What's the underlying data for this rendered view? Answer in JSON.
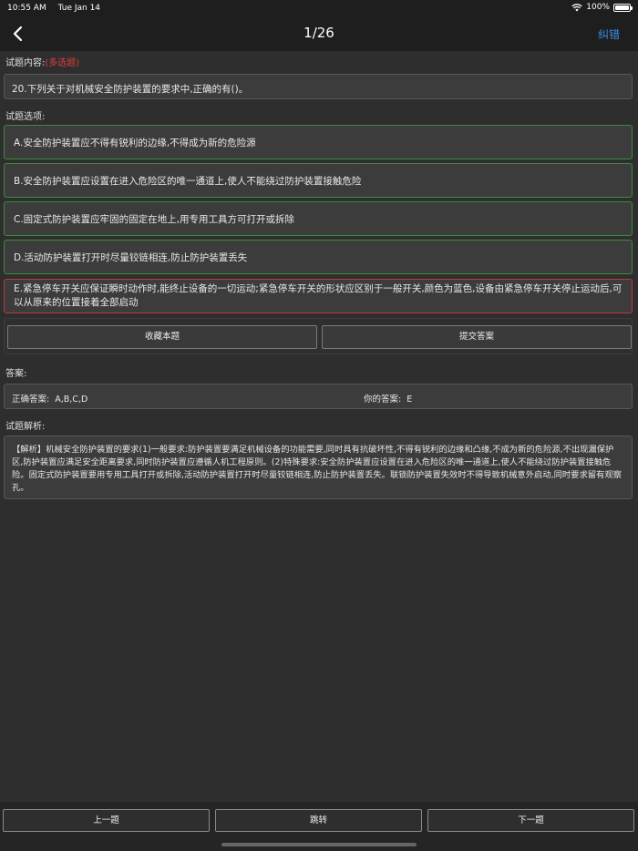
{
  "status_bar": {
    "time": "10:55 AM",
    "date": "Tue Jan 14",
    "battery_percent": "100%",
    "battery_level": 1.0
  },
  "nav": {
    "title": "1/26",
    "report_label": "纠错",
    "back_icon": "chevron-left-icon"
  },
  "question": {
    "section_label": "试题内容:",
    "type_label": "(多选题)",
    "text": "20.下列关于对机械安全防护装置的要求中,正确的有()。"
  },
  "options": {
    "section_label": "试题选项:",
    "items": [
      {
        "text": "A.安全防护装置应不得有锐利的边缘,不得成为新的危险源",
        "state": "correct"
      },
      {
        "text": "B.安全防护装置应设置在进入危险区的唯一通道上,使人不能绕过防护装置接触危险",
        "state": "correct"
      },
      {
        "text": "C.固定式防护装置应牢固的固定在地上,用专用工具方可打开或拆除",
        "state": "correct"
      },
      {
        "text": "D.活动防护装置打开时尽量铰链相连,防止防护装置丢失",
        "state": "correct"
      },
      {
        "text": "E.紧急停车开关应保证瞬时动作时,能终止设备的一切运动;紧急停车开关的形状应区别于一般开关,颜色为蓝色,设备由紧急停车开关停止运动后,可以从原来的位置接着全部启动",
        "state": "wrong"
      }
    ],
    "correct_border_color": "#3e8a3e",
    "wrong_border_color": "#b83a3a"
  },
  "actions": {
    "favorite_label": "收藏本题",
    "submit_label": "提交答案"
  },
  "answer": {
    "section_label": "答案:",
    "correct_label": "正确答案:",
    "correct_value": "A,B,C,D",
    "yours_label": "你的答案:",
    "yours_value": "E"
  },
  "analysis": {
    "section_label": "试题解析:",
    "text": "【解析】机械安全防护装置的要求(1)一般要求:防护装置要满足机械设备的功能需要,同时具有抗破坏性,不得有锐利的边缘和凸缘,不成为新的危险源,不出现漏保护区,防护装置应满足安全距离要求,同时防护装置应遵循人机工程原则。(2)特殊要求:安全防护装置应设置在进入危险区的唯一通道上,使人不能绕过防护装置接触危险。固定式防护装置要用专用工具打开或拆除,活动防护装置打开时尽量铰链相连,防止防护装置丢失。联锁防护装置失效时不得导致机械意外启动,同时要求留有观察孔。"
  },
  "bottom": {
    "prev_label": "上一题",
    "jump_label": "跳转",
    "next_label": "下一题"
  }
}
